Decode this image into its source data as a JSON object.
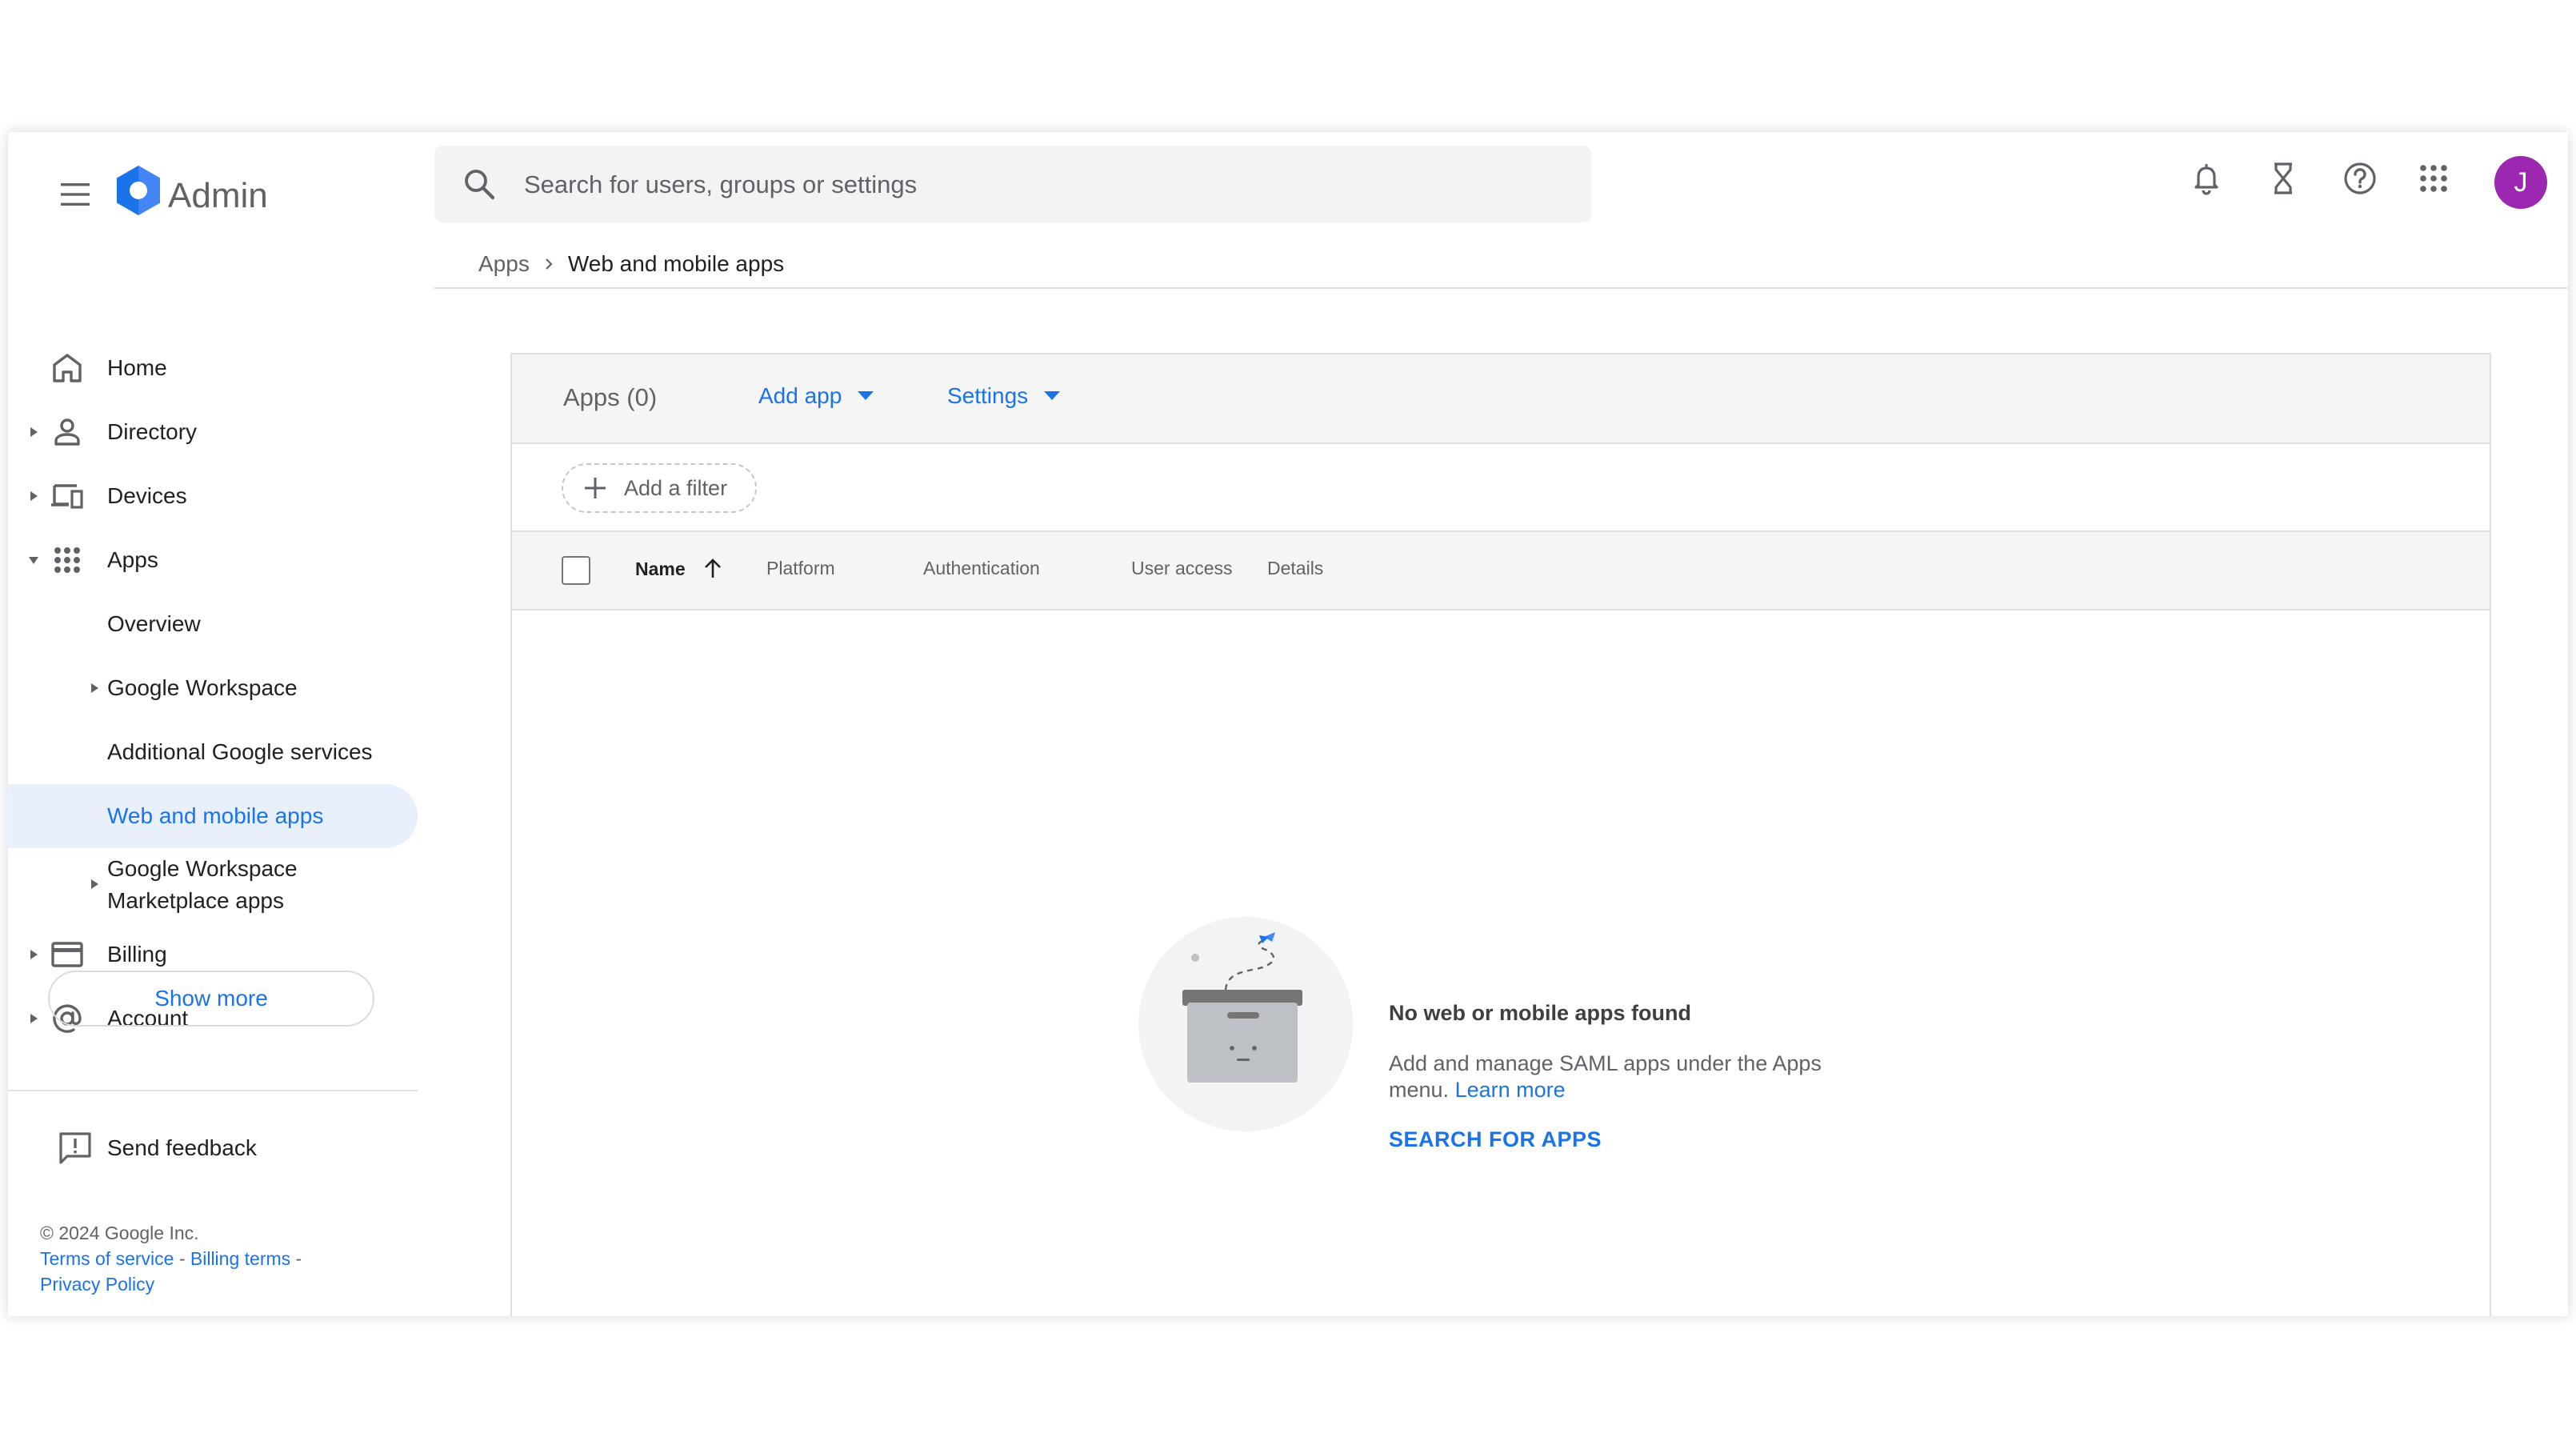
{
  "app": {
    "brand": "Admin"
  },
  "search": {
    "placeholder": "Search for users, groups or settings"
  },
  "header": {
    "icons": [
      "bell-icon",
      "hourglass-icon",
      "help-icon",
      "apps-grid-icon"
    ],
    "avatar_initial": "J",
    "avatar_color": "#9c27b0"
  },
  "sidebar": {
    "items": [
      {
        "label": "Home",
        "icon": "home-icon"
      },
      {
        "label": "Directory",
        "icon": "person-icon"
      },
      {
        "label": "Devices",
        "icon": "devices-icon"
      },
      {
        "label": "Apps",
        "icon": "apps-icon",
        "expanded": true
      },
      {
        "label": "Overview"
      },
      {
        "label": "Google Workspace"
      },
      {
        "label": "Additional Google services"
      },
      {
        "label": "Web and mobile apps",
        "active": true
      },
      {
        "label": "Google Workspace"
      },
      {
        "label": "Billing",
        "icon": "credit-card-icon"
      },
      {
        "label": "Account",
        "icon": "at-sign-icon"
      }
    ],
    "marketplace_line2": "Marketplace apps",
    "show_more": "Show more",
    "feedback": "Send feedback",
    "footer": {
      "copyright": "© 2024 Google Inc.",
      "terms": "Terms of service",
      "billing": "Billing terms",
      "sep": " - ",
      "privacy": "Privacy Policy"
    }
  },
  "breadcrumb": {
    "parent": "Apps",
    "current": "Web and mobile apps"
  },
  "panel": {
    "title": "Apps (0)",
    "add_app": "Add app",
    "settings": "Settings",
    "add_filter": "Add a filter",
    "columns": [
      "Name",
      "Platform",
      "Authentication",
      "User access",
      "Details"
    ]
  },
  "empty": {
    "title": "No web or mobile apps found",
    "desc": "Add and manage SAML apps under the Apps menu.",
    "learn_more": "Learn more",
    "action": "SEARCH FOR APPS"
  },
  "colors": {
    "accent": "#1a73e8",
    "active_bg": "#e8f0fe",
    "text": "#202124",
    "muted": "#5f6368"
  }
}
